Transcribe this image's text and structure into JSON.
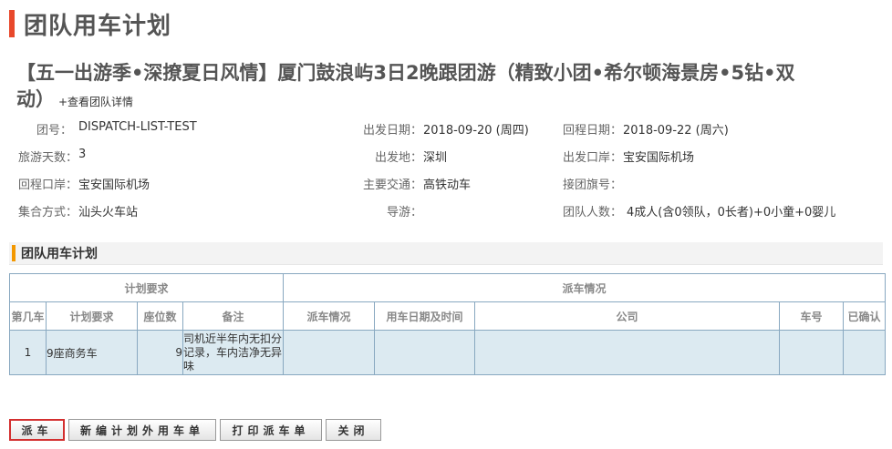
{
  "page_title": "团队用车计划",
  "tour": {
    "name": "【五一出游季•深撩夏日风情】厦门鼓浪屿3日2晚跟团游（精致小团•希尔顿海景房•5钻•双动）",
    "details_link": "+查看团队详情"
  },
  "info": {
    "group_no_label": "团号：",
    "group_no": "DISPATCH-LIST-TEST",
    "depart_date_label": "出发日期：",
    "depart_date": "2018-09-20 (周四)",
    "return_date_label": "回程日期：",
    "return_date": "2018-09-22 (周六)",
    "days_label": "旅游天数：",
    "days": "3",
    "depart_place_label": "出发地：",
    "depart_place": "深圳",
    "depart_port_label": "出发口岸：",
    "depart_port": "宝安国际机场",
    "return_port_label": "回程口岸：",
    "return_port": "宝安国际机场",
    "transport_label": "主要交通：",
    "transport": "高铁动车",
    "flag_no_label": "接团旗号：",
    "flag_no": "",
    "gather_label": "集合方式：",
    "gather": "汕头火车站",
    "guide_label": "导游：",
    "guide": "",
    "people_label": "团队人数：",
    "people": "4成人(含0领队，0长者)+0小童+0婴儿"
  },
  "section_title": "团队用车计划",
  "table": {
    "group_plan": "计划要求",
    "group_dispatch": "派车情况",
    "columns": [
      "第几车",
      "计划要求",
      "座位数",
      "备注",
      "派车情况",
      "用车日期及时间",
      "公司",
      "车号",
      "已确认"
    ],
    "rows": [
      {
        "car_no": "1",
        "plan": "9座商务车",
        "seats": "9",
        "remark": "司机近半年内无扣分记录，车内洁净无异味",
        "dispatch": "",
        "datetime": "",
        "company": "",
        "plate": "",
        "confirmed": ""
      }
    ]
  },
  "buttons": {
    "dispatch": "派车",
    "new_extra": "新编计划外用车单",
    "print": "打印派车单",
    "close": "关闭"
  }
}
